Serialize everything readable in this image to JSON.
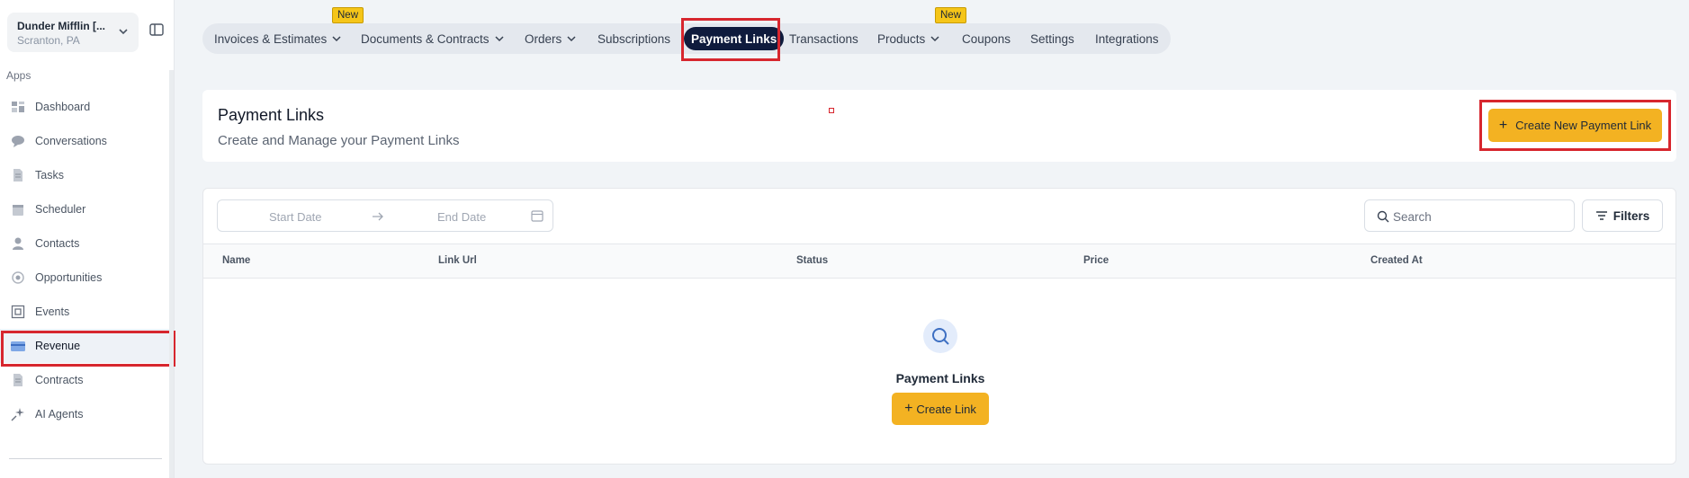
{
  "sidebar": {
    "account_name": "Dunder Mifflin [...",
    "account_location": "Scranton, PA",
    "section_label": "Apps",
    "items": [
      {
        "label": "Dashboard",
        "icon": "dashboard-icon"
      },
      {
        "label": "Conversations",
        "icon": "chat-icon"
      },
      {
        "label": "Tasks",
        "icon": "document-icon"
      },
      {
        "label": "Scheduler",
        "icon": "calendar-icon"
      },
      {
        "label": "Contacts",
        "icon": "person-icon"
      },
      {
        "label": "Opportunities",
        "icon": "target-icon"
      },
      {
        "label": "Events",
        "icon": "events-icon"
      },
      {
        "label": "Revenue",
        "icon": "card-icon",
        "active": true
      },
      {
        "label": "Contracts",
        "icon": "document-icon"
      },
      {
        "label": "AI Agents",
        "icon": "sparkle-icon"
      }
    ]
  },
  "tabs": [
    {
      "label": "Invoices & Estimates",
      "dropdown": true,
      "badge": "New"
    },
    {
      "label": "Documents & Contracts",
      "dropdown": true
    },
    {
      "label": "Orders",
      "dropdown": true
    },
    {
      "label": "Subscriptions"
    },
    {
      "label": "Payment Links",
      "active": true
    },
    {
      "label": "Transactions"
    },
    {
      "label": "Products",
      "dropdown": true,
      "badge": "New"
    },
    {
      "label": "Coupons"
    },
    {
      "label": "Settings"
    },
    {
      "label": "Integrations"
    }
  ],
  "header": {
    "title": "Payment Links",
    "subtitle": "Create and Manage your Payment Links",
    "create_button": "Create New Payment Link"
  },
  "toolbar": {
    "start_date_placeholder": "Start Date",
    "end_date_placeholder": "End Date",
    "search_placeholder": "Search",
    "filters_label": "Filters"
  },
  "table": {
    "columns": [
      "Name",
      "Link Url",
      "Status",
      "Price",
      "Created At"
    ],
    "rows": []
  },
  "empty_state": {
    "title": "Payment Links",
    "button": "Create Link"
  },
  "colors": {
    "accent": "#f3b222",
    "active_tab": "#0f1b3d",
    "highlight": "#d7262e",
    "badge": "#f5c518"
  }
}
